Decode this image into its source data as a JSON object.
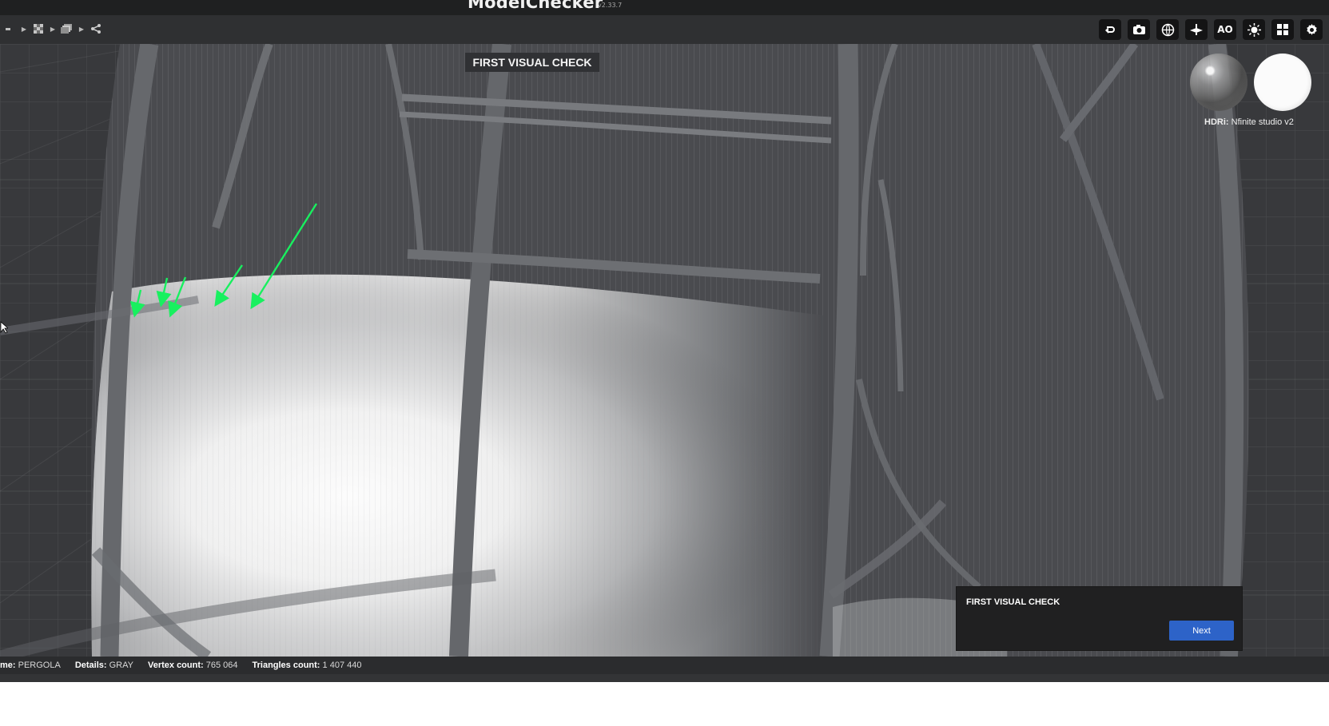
{
  "app": {
    "brand": "ModelChecker",
    "version": "v2.33.7"
  },
  "toolbar": {
    "breadcrumb_icons": [
      "grid-icon",
      "checker-icon",
      "layers-icon",
      "share-icon"
    ],
    "actions": [
      {
        "name": "undo-view-icon",
        "label": ""
      },
      {
        "name": "camera-icon",
        "label": ""
      },
      {
        "name": "globe-icon",
        "label": ""
      },
      {
        "name": "ground-plane-icon",
        "label": ""
      },
      {
        "name": "ao-icon",
        "label": "AO"
      },
      {
        "name": "light-icon",
        "label": ""
      },
      {
        "name": "grid-view-icon",
        "label": ""
      },
      {
        "name": "settings-icon",
        "label": ""
      }
    ]
  },
  "viewport": {
    "overlay_title": "FIRST VISUAL CHECK",
    "hdri": {
      "label_prefix": "HDRi:",
      "label_value": "Nfinite studio v2"
    }
  },
  "dialog": {
    "title": "FIRST VISUAL CHECK",
    "next_label": "Next"
  },
  "statusbar": {
    "name_label": "me:",
    "name_value": "PERGOLA",
    "details_label": "Details:",
    "details_value": "GRAY",
    "vertex_label": "Vertex count:",
    "vertex_value": "765 064",
    "triangles_label": "Triangles count:",
    "triangles_value": "1 407 440"
  },
  "colors": {
    "accent": "#2d63c8",
    "arrow": "#18f05f",
    "toolbar": "#2f3032",
    "titlebar": "#1f2021"
  }
}
